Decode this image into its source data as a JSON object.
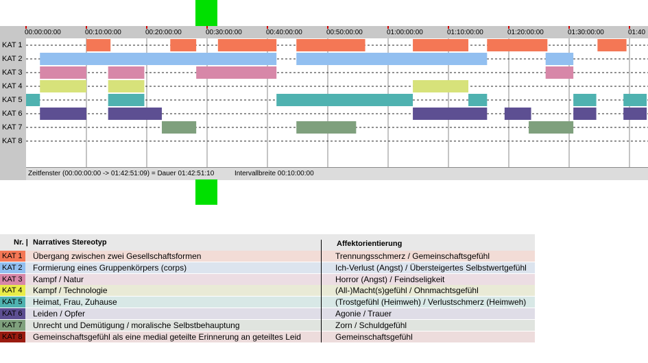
{
  "timeline": {
    "ticks": [
      "00:00:00:00",
      "00:10:00:00",
      "00:20:00:00",
      "00:30:00:00",
      "00:40:00:00",
      "00:50:00:00",
      "01:00:00:00",
      "01:10:00:00",
      "01:20:00:00",
      "01:30:00:00",
      "01:40"
    ],
    "row_labels": [
      "KAT 1",
      "KAT 2",
      "KAT 3",
      "KAT 4",
      "KAT 5",
      "KAT 6",
      "KAT 7",
      "KAT 8"
    ],
    "status_window": "Zeitfenster (00:00:00:00 -> 01:42:51:09) = Dauer 01:42:51:10",
    "status_interval": "Intervallbreite 00:10:00:00"
  },
  "chart_data": {
    "type": "timeline",
    "x_unit": "minutes",
    "x_range": [
      0,
      102.85
    ],
    "tick_interval_minutes": 10,
    "categories": [
      "KAT 1",
      "KAT 2",
      "KAT 3",
      "KAT 4",
      "KAT 5",
      "KAT 6",
      "KAT 7",
      "KAT 8"
    ],
    "colors": [
      "#f47755",
      "#92bff0",
      "#d787a8",
      "#d7e27a",
      "#4fb2b0",
      "#5d4f92",
      "#7fa07d",
      "#9a1b10"
    ],
    "segments": {
      "KAT 1": [
        [
          10.0,
          14.0
        ],
        [
          23.9,
          28.2
        ],
        [
          31.8,
          41.5
        ],
        [
          44.8,
          56.2
        ],
        [
          64.1,
          73.3
        ],
        [
          76.4,
          86.4
        ],
        [
          94.7,
          99.5
        ]
      ],
      "KAT 2": [
        [
          2.3,
          41.5
        ],
        [
          44.8,
          76.4
        ],
        [
          86.1,
          90.7
        ]
      ],
      "KAT 3": [
        [
          2.3,
          10.0
        ],
        [
          13.6,
          19.6
        ],
        [
          28.2,
          41.5
        ],
        [
          86.1,
          90.7
        ]
      ],
      "KAT 4": [
        [
          2.3,
          10.0
        ],
        [
          13.6,
          19.6
        ],
        [
          64.1,
          73.3
        ]
      ],
      "KAT 5": [
        [
          0.0,
          2.3
        ],
        [
          13.6,
          19.6
        ],
        [
          41.5,
          64.1
        ],
        [
          73.3,
          76.4
        ],
        [
          90.7,
          94.5
        ],
        [
          99.0,
          102.85
        ]
      ],
      "KAT 6": [
        [
          2.3,
          10.0
        ],
        [
          13.6,
          22.5
        ],
        [
          64.1,
          76.4
        ],
        [
          79.3,
          83.7
        ],
        [
          90.7,
          94.5
        ],
        [
          99.0,
          102.85
        ]
      ],
      "KAT 7": [
        [
          22.5,
          28.2
        ],
        [
          44.8,
          54.7
        ],
        [
          83.3,
          90.7
        ]
      ],
      "KAT 8": []
    }
  },
  "legend": {
    "header_nr": "Nr. |",
    "header_stereotype": "Narratives Stereotyp",
    "header_affect": "Affektorientierung",
    "rows": [
      {
        "kat": "KAT 1",
        "color": "#f47755",
        "bg": "#f2dcd6",
        "stereotype": "Übergang zwischen zwei Gesellschaftsformen",
        "affect": "Trennungsschmerz / Gemeinschaftsgefühl"
      },
      {
        "kat": "KAT 2",
        "color": "#92bff0",
        "bg": "#dce4ee",
        "stereotype": "Formierung eines Gruppenkörpers (corps)",
        "affect": "Ich-Verlust (Angst) / Übersteigertes Selbstwertgefühl"
      },
      {
        "kat": "KAT 3",
        "color": "#d787a8",
        "bg": "#ecdde3",
        "stereotype": "Kampf / Natur",
        "affect": "Horror (Angst) / Feindseligkeit"
      },
      {
        "kat": "KAT 4",
        "color": "#e8ec48",
        "bg": "#e9ead6",
        "stereotype": "Kampf / Technologie",
        "affect": "(All-)Macht(s)gefühl / Ohnmachtsgefühl"
      },
      {
        "kat": "KAT 5",
        "color": "#4fb2b0",
        "bg": "#d8e8e6",
        "stereotype": "Heimat, Frau, Zuhause",
        "affect": "(Trostgefühl (Heimweh) / Verlustschmerz (Heimweh)"
      },
      {
        "kat": "KAT 6",
        "color": "#5d4f92",
        "bg": "#dfdde7",
        "stereotype": "Leiden / Opfer",
        "affect": "Agonie / Trauer"
      },
      {
        "kat": "KAT 7",
        "color": "#7fa07d",
        "bg": "#e0e4df",
        "stereotype": "Unrecht und Demütigung / moralische Selbstbehauptung",
        "affect": "Zorn / Schuldgefühl"
      },
      {
        "kat": "KAT 8",
        "color": "#9a1b10",
        "bg": "#eddcdc",
        "stereotype": "Gemeinschaftsgefühl als eine medial geteilte Erinnerung an geteiltes Leid",
        "affect": "Gemeinschaftsgefühl"
      }
    ]
  }
}
